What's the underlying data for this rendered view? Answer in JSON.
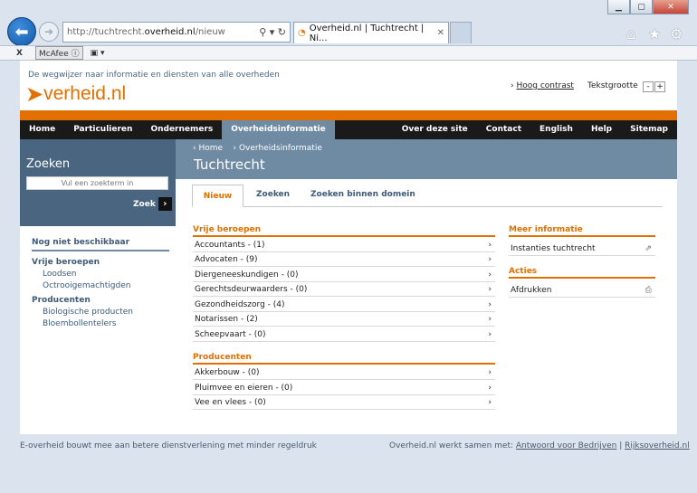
{
  "browser": {
    "url_prefix": "http://tuchtrecht.",
    "url_domain": "overheid.nl",
    "url_suffix": "/nieuw",
    "tab_title": "Overheid.nl | Tuchtrecht | Ni...",
    "toolbar_close": "X",
    "toolbar_mcafee": "McAfee"
  },
  "header": {
    "tagline": "De wegwijzer naar informatie en diensten van alle overheden",
    "logo_text": "verheid.nl",
    "high_contrast": "Hoog contrast",
    "text_size": "Tekstgrootte",
    "minus": "-",
    "plus": "+"
  },
  "nav": {
    "left": [
      "Home",
      "Particulieren",
      "Ondernemers",
      "Overheidsinformatie"
    ],
    "right": [
      "Over deze site",
      "Contact",
      "English",
      "Help",
      "Sitemap"
    ]
  },
  "search": {
    "title": "Zoeken",
    "placeholder": "Vul een zoekterm in",
    "button": "Zoek"
  },
  "breadcrumb": {
    "home": "Home",
    "current": "Overheidsinformatie"
  },
  "page_title": "Tuchtrecht",
  "tabs": [
    "Nieuw",
    "Zoeken",
    "Zoeken binnen domein"
  ],
  "sidebar": {
    "heading": "Nog niet beschikbaar",
    "groups": [
      {
        "title": "Vrije beroepen",
        "items": [
          "Loodsen",
          "Octrooigemachtigden"
        ]
      },
      {
        "title": "Producenten",
        "items": [
          "Biologische producten",
          "Bloembollentelers"
        ]
      }
    ]
  },
  "main": {
    "sections": [
      {
        "title": "Vrije beroepen",
        "items": [
          "Accountants - (1)",
          "Advocaten - (9)",
          "Diergeneeskundigen - (0)",
          "Gerechtsdeurwaarders - (0)",
          "Gezondheidszorg - (4)",
          "Notarissen - (2)",
          "Scheepvaart - (0)"
        ]
      },
      {
        "title": "Producenten",
        "items": [
          "Akkerbouw - (0)",
          "Pluimvee en eieren - (0)",
          "Vee en vlees - (0)"
        ]
      }
    ]
  },
  "right": {
    "more_title": "Meer informatie",
    "more_item": "Instanties tuchtrecht",
    "actions_title": "Acties",
    "actions_item": "Afdrukken"
  },
  "footer": {
    "left": "E-overheid bouwt mee aan betere dienstverlening met minder regeldruk",
    "right_prefix": "Overheid.nl werkt samen met: ",
    "link1": "Antwoord voor Bedrijven",
    "sep": " | ",
    "link2": "Rijksoverheid.nl"
  },
  "colors": {
    "accent": "#e17000",
    "nav": "#1a1a1a",
    "band": "#6f8aa3",
    "search": "#4a6580"
  }
}
